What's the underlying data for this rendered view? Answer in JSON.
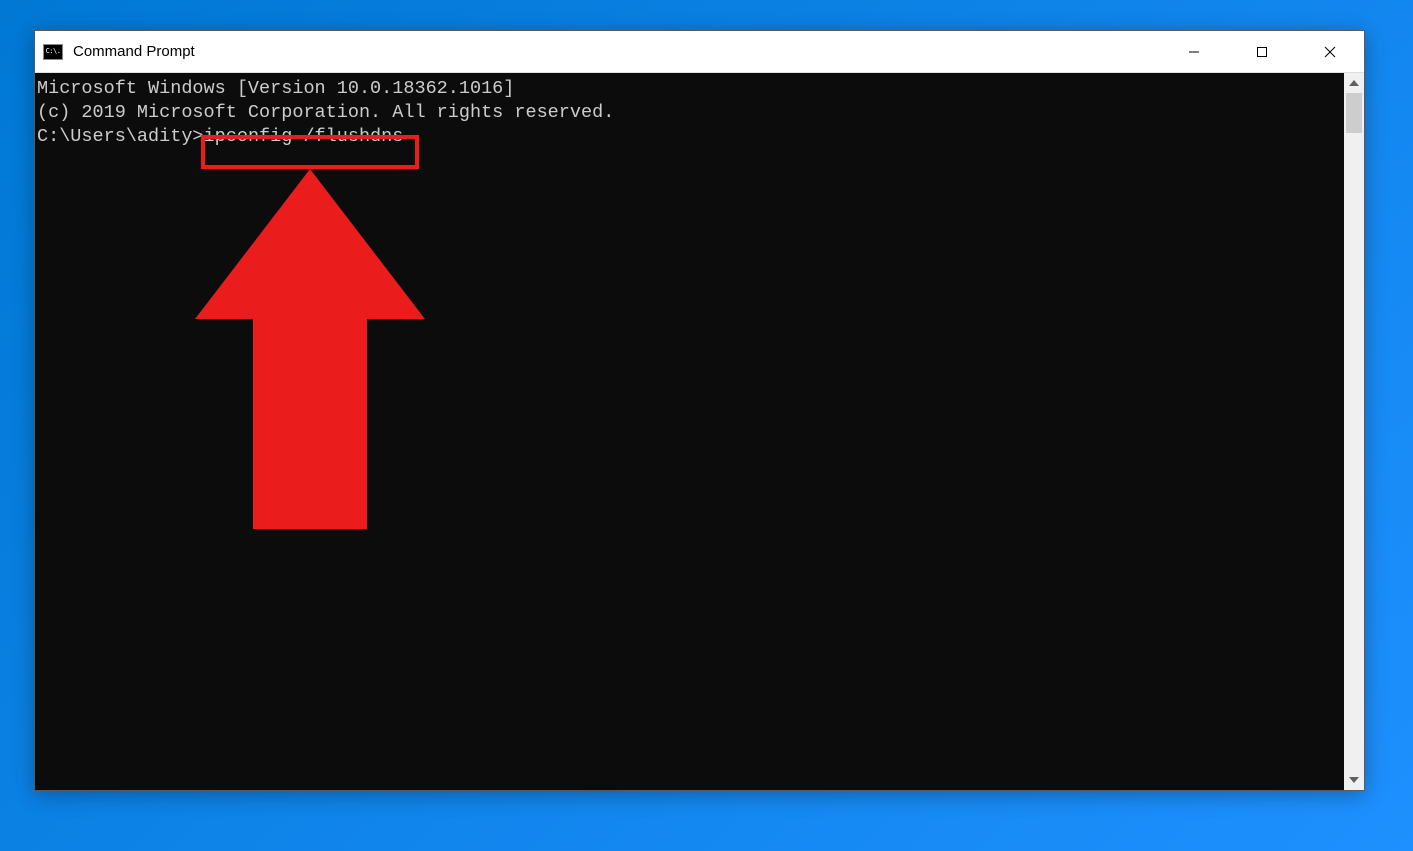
{
  "window": {
    "title": "Command Prompt",
    "icon_text": "C:\\."
  },
  "terminal": {
    "line1": "Microsoft Windows [Version 10.0.18362.1016]",
    "line2": "(c) 2019 Microsoft Corporation. All rights reserved.",
    "blank": "",
    "prompt": "C:\\Users\\adity>",
    "command": "ipconfig /flushdns"
  },
  "annotation": {
    "highlight_color": "#ea1c1c",
    "arrow_color": "#ea1c1c"
  }
}
